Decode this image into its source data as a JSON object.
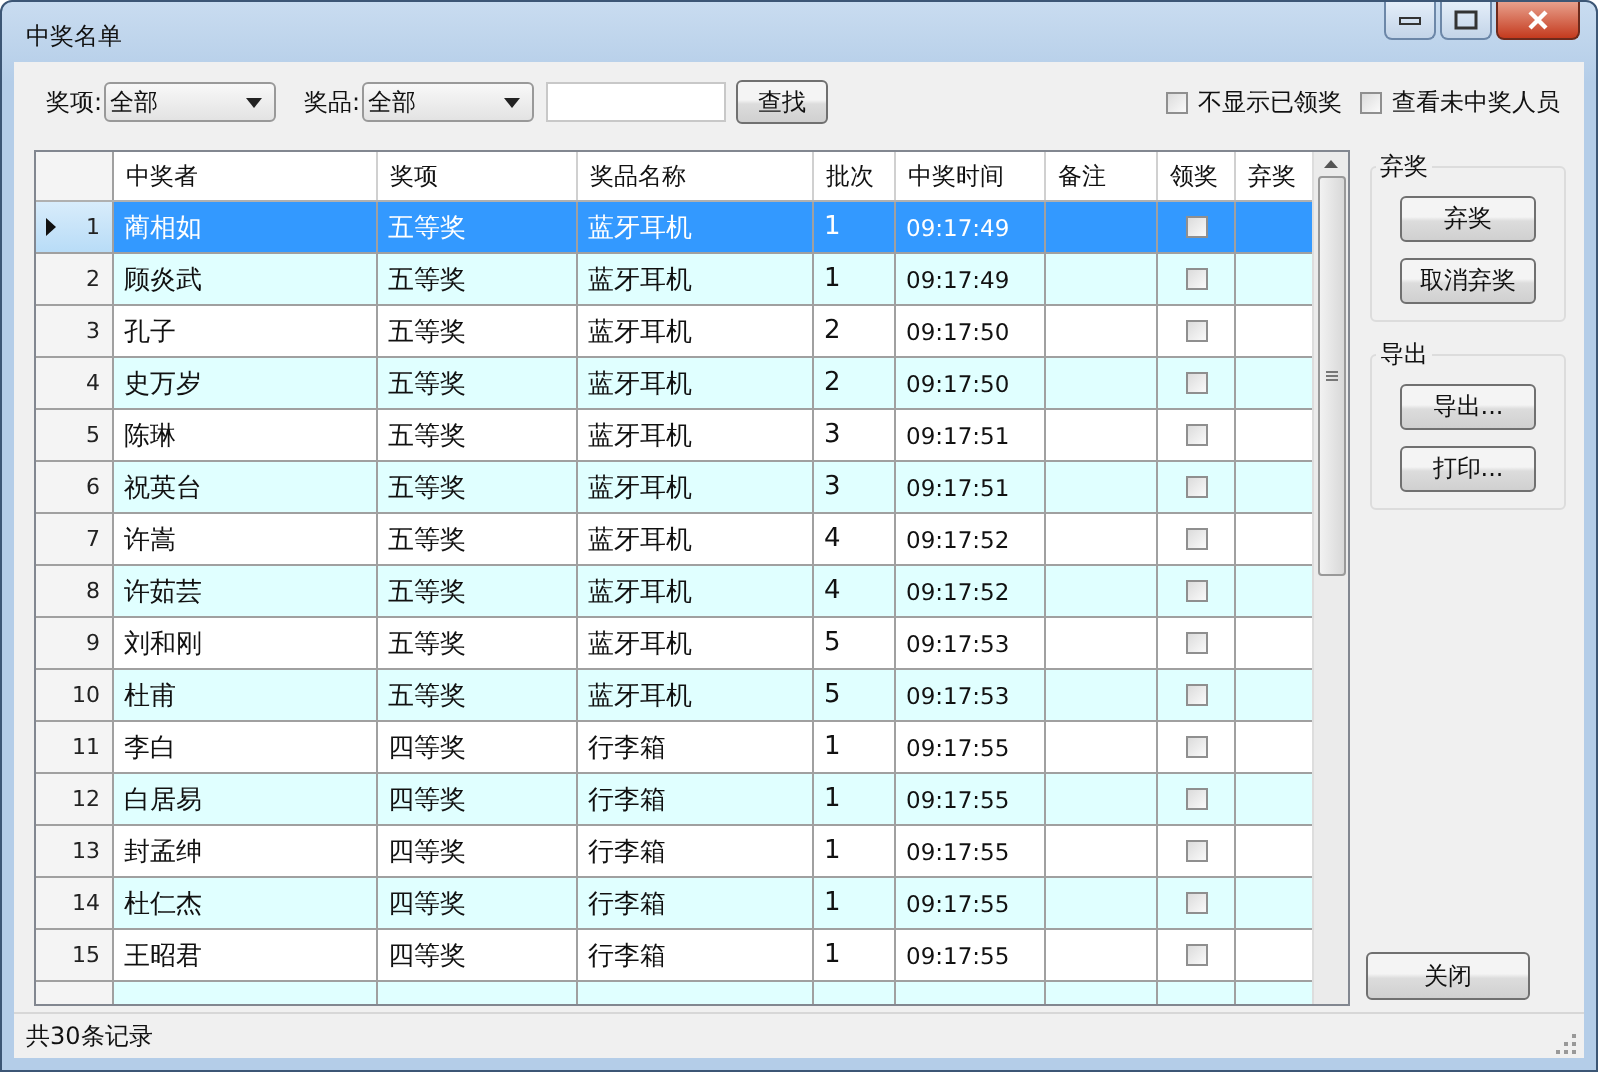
{
  "window": {
    "title": "中奖名单"
  },
  "filters": [
    {
      "label": "奖项:",
      "value": "全部"
    },
    {
      "label": "奖品:",
      "value": "全部"
    }
  ],
  "search": {
    "button": "查找"
  },
  "options": [
    {
      "label": "不显示已领奖",
      "checked": false
    },
    {
      "label": "查看未中奖人员",
      "checked": false
    }
  ],
  "table": {
    "columns": [
      "中奖者",
      "奖项",
      "奖品名称",
      "批次",
      "中奖时间",
      "备注",
      "领奖",
      "弃奖"
    ],
    "rows": [
      {
        "index": "1",
        "winner": "蔺相如",
        "level": "五等奖",
        "prize": "蓝牙耳机",
        "batch": "1",
        "time": "09:17:49",
        "claimed": false,
        "selected": true
      },
      {
        "index": "2",
        "winner": "顾炎武",
        "level": "五等奖",
        "prize": "蓝牙耳机",
        "batch": "1",
        "time": "09:17:49",
        "claimed": false,
        "selected": false
      },
      {
        "index": "3",
        "winner": "孔子",
        "level": "五等奖",
        "prize": "蓝牙耳机",
        "batch": "2",
        "time": "09:17:50",
        "claimed": false,
        "selected": false
      },
      {
        "index": "4",
        "winner": "史万岁",
        "level": "五等奖",
        "prize": "蓝牙耳机",
        "batch": "2",
        "time": "09:17:50",
        "claimed": false,
        "selected": false
      },
      {
        "index": "5",
        "winner": "陈琳",
        "level": "五等奖",
        "prize": "蓝牙耳机",
        "batch": "3",
        "time": "09:17:51",
        "claimed": false,
        "selected": false
      },
      {
        "index": "6",
        "winner": "祝英台",
        "level": "五等奖",
        "prize": "蓝牙耳机",
        "batch": "3",
        "time": "09:17:51",
        "claimed": false,
        "selected": false
      },
      {
        "index": "7",
        "winner": "许嵩",
        "level": "五等奖",
        "prize": "蓝牙耳机",
        "batch": "4",
        "time": "09:17:52",
        "claimed": false,
        "selected": false
      },
      {
        "index": "8",
        "winner": "许茹芸",
        "level": "五等奖",
        "prize": "蓝牙耳机",
        "batch": "4",
        "time": "09:17:52",
        "claimed": false,
        "selected": false
      },
      {
        "index": "9",
        "winner": "刘和刚",
        "level": "五等奖",
        "prize": "蓝牙耳机",
        "batch": "5",
        "time": "09:17:53",
        "claimed": false,
        "selected": false
      },
      {
        "index": "10",
        "winner": "杜甫",
        "level": "五等奖",
        "prize": "蓝牙耳机",
        "batch": "5",
        "time": "09:17:53",
        "claimed": false,
        "selected": false
      },
      {
        "index": "11",
        "winner": "李白",
        "level": "四等奖",
        "prize": "行李箱",
        "batch": "1",
        "time": "09:17:55",
        "claimed": false,
        "selected": false
      },
      {
        "index": "12",
        "winner": "白居易",
        "level": "四等奖",
        "prize": "行李箱",
        "batch": "1",
        "time": "09:17:55",
        "claimed": false,
        "selected": false
      },
      {
        "index": "13",
        "winner": "封孟绅",
        "level": "四等奖",
        "prize": "行李箱",
        "batch": "1",
        "time": "09:17:55",
        "claimed": false,
        "selected": false
      },
      {
        "index": "14",
        "winner": "杜仁杰",
        "level": "四等奖",
        "prize": "行李箱",
        "batch": "1",
        "time": "09:17:55",
        "claimed": false,
        "selected": false
      },
      {
        "index": "15",
        "winner": "王昭君",
        "level": "四等奖",
        "prize": "行李箱",
        "batch": "1",
        "time": "09:17:55",
        "claimed": false,
        "selected": false
      }
    ]
  },
  "groups": [
    {
      "title": "弃奖",
      "buttons": [
        "弃奖",
        "取消弃奖"
      ]
    },
    {
      "title": "导出",
      "buttons": [
        "导出...",
        "打印..."
      ]
    }
  ],
  "close_button": "关闭",
  "status_bar": "共30条记录"
}
